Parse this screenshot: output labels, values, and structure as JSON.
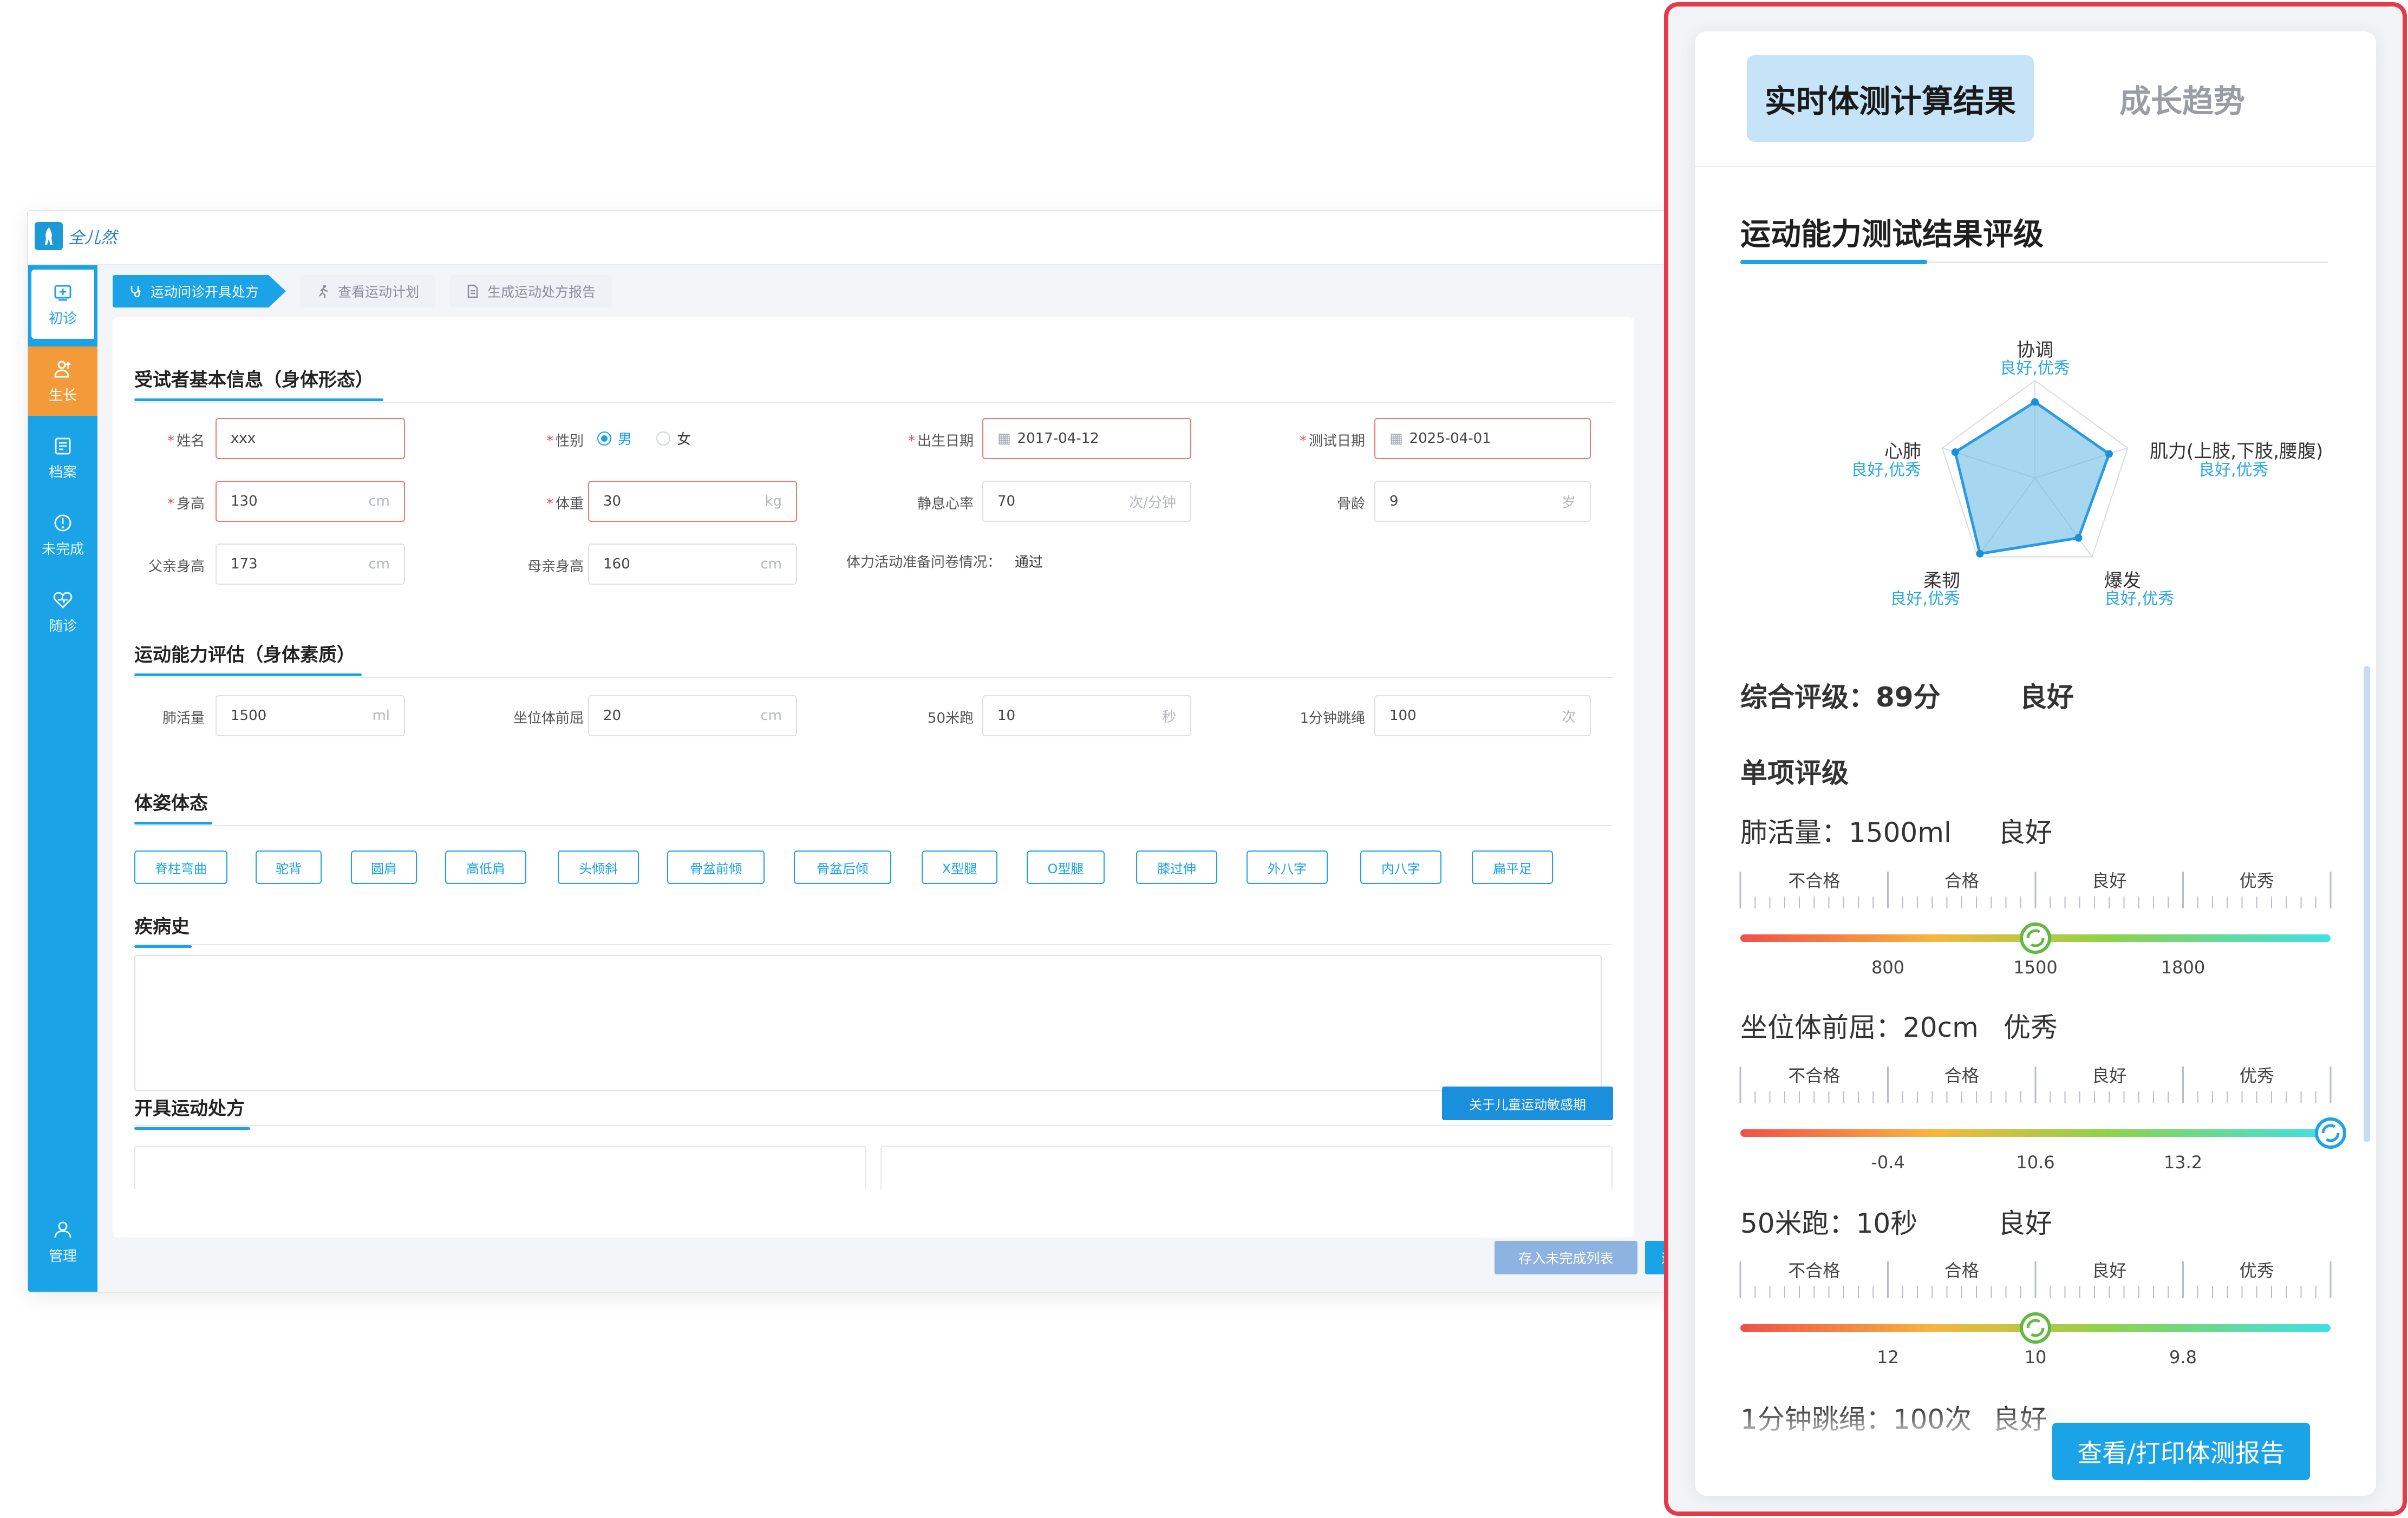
{
  "app": {
    "logo_text": "全儿然",
    "sidebar": [
      {
        "label": "初诊",
        "icon": "clinic-icon"
      },
      {
        "label": "生长",
        "icon": "growth-icon"
      },
      {
        "label": "档案",
        "icon": "archive-icon"
      },
      {
        "label": "未完成",
        "icon": "pending-icon"
      },
      {
        "label": "随诊",
        "icon": "followup-icon"
      },
      {
        "label": "管理",
        "icon": "user-admin-icon"
      }
    ],
    "tabs": [
      "运动问诊开具处方",
      "查看运动计划",
      "生成运动处方报告"
    ],
    "sections": {
      "basic": "受试者基本信息（身体形态）",
      "ability": "运动能力评估（身体素质）",
      "posture": "体姿体态",
      "history": "疾病史",
      "prescription": "开具运动处方"
    },
    "basic": {
      "name_label": "姓名",
      "name": "xxx",
      "gender_label": "性别",
      "gender_male": "男",
      "gender_female": "女",
      "birth_label": "出生日期",
      "birth": "2017-04-12",
      "test_date_label": "测试日期",
      "test_date": "2025-04-01",
      "height_label": "身高",
      "height": "130",
      "height_unit": "cm",
      "weight_label": "体重",
      "weight": "30",
      "weight_unit": "kg",
      "hr_label": "静息心率",
      "hr": "70",
      "hr_unit": "次/分钟",
      "bone_label": "骨龄",
      "bone": "9",
      "bone_unit": "岁",
      "father_label": "父亲身高",
      "father": "173",
      "father_unit": "cm",
      "mother_label": "母亲身高",
      "mother": "160",
      "mother_unit": "cm",
      "parq_label": "体力活动准备问卷情况：",
      "parq": "通过"
    },
    "ability": {
      "lung_label": "肺活量",
      "lung": "1500",
      "lung_unit": "ml",
      "sit_label": "坐位体前屈",
      "sit": "20",
      "sit_unit": "cm",
      "run_label": "50米跑",
      "run": "10",
      "run_unit": "秒",
      "rope_label": "1分钟跳绳",
      "rope": "100",
      "rope_unit": "次"
    },
    "posture_items": [
      "脊柱弯曲",
      "驼背",
      "圆肩",
      "高低肩",
      "头倾斜",
      "骨盆前倾",
      "骨盆后倾",
      "X型腿",
      "O型腿",
      "膝过伸",
      "外八字",
      "内八字",
      "扁平足"
    ],
    "buttons": {
      "sensitive": "关于儿童运动敏感期",
      "save": "存入未完成列表",
      "next": "运动"
    }
  },
  "panel": {
    "tab_active": "实时体测计算结果",
    "tab_other": "成长趋势",
    "title": "运动能力测试结果评级",
    "radar": [
      {
        "label": "协调",
        "grade": "良好,优秀",
        "value": 0.78
      },
      {
        "label": "肌力(上肢,下肢,腰腹)",
        "grade": "良好,优秀",
        "value": 0.8
      },
      {
        "label": "爆发",
        "grade": "良好,优秀",
        "value": 0.76
      },
      {
        "label": "柔韧",
        "grade": "良好,优秀",
        "value": 0.96
      },
      {
        "label": "心肺",
        "grade": "良好,优秀",
        "value": 0.86
      }
    ],
    "overall": "综合评级：89分",
    "overall_grade": "良好",
    "single_title": "单项评级",
    "scale_levels": [
      "不合格",
      "合格",
      "良好",
      "优秀"
    ],
    "metrics": [
      {
        "head": "肺活量：1500ml",
        "grade": "良好",
        "ticks": [
          "800",
          "1500",
          "1800"
        ],
        "position": 0.5
      },
      {
        "head": "坐位体前屈：20cm",
        "grade": "优秀",
        "ticks": [
          "-0.4",
          "10.6",
          "13.2"
        ],
        "position": 1.0
      },
      {
        "head": "50米跑：10秒",
        "grade": "良好",
        "ticks": [
          "12",
          "10",
          "9.8"
        ],
        "position": 0.5
      },
      {
        "head": "1分钟跳绳：100次",
        "grade": "良好"
      }
    ],
    "print_button": "查看/打印体测报告"
  }
}
